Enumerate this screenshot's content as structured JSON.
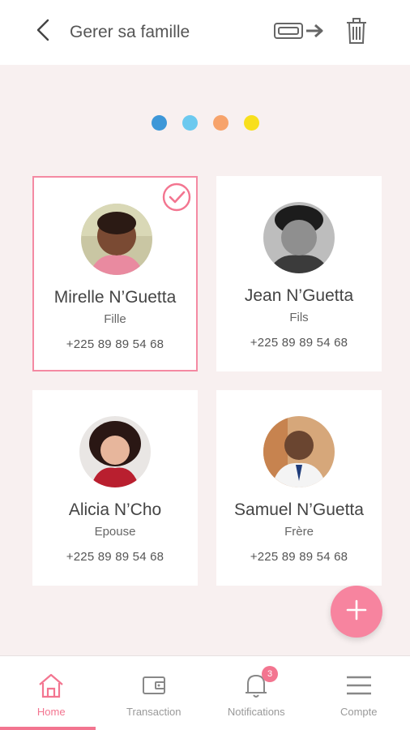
{
  "header": {
    "title": "Gerer sa famille",
    "back_icon": "chevron-left-icon",
    "export_icon": "card-export-icon",
    "delete_icon": "trash-icon"
  },
  "pager": {
    "dot_colors": [
      "#3d97d8",
      "#6cc9ef",
      "#f7a36b",
      "#f8df1d"
    ]
  },
  "members": [
    {
      "name": "Mirelle N’Guetta",
      "relation": "Fille",
      "phone": "+225 89 89 54 68",
      "selected": true
    },
    {
      "name": "Jean N’Guetta",
      "relation": "Fils",
      "phone": "+225 89 89 54 68",
      "selected": false
    },
    {
      "name": "Alicia N’Cho",
      "relation": "Epouse",
      "phone": "+225 89 89 54 68",
      "selected": false
    },
    {
      "name": "Samuel N’Guetta",
      "relation": "Frère",
      "phone": "+225 89 89 54 68",
      "selected": false
    }
  ],
  "fab": {
    "icon": "plus-icon"
  },
  "nav": {
    "items": [
      {
        "label": "Home",
        "icon": "home-icon",
        "active": true
      },
      {
        "label": "Transaction",
        "icon": "wallet-icon",
        "active": false
      },
      {
        "label": "Notifications",
        "icon": "bell-icon",
        "active": false,
        "badge": "3"
      },
      {
        "label": "Compte",
        "icon": "menu-icon",
        "active": false
      }
    ]
  },
  "colors": {
    "accent": "#f37590",
    "background": "#f8f0f0"
  }
}
